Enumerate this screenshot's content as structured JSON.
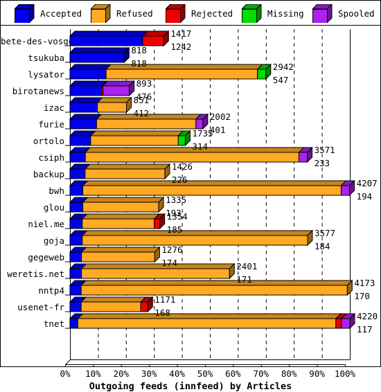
{
  "legend": {
    "items": [
      {
        "label": "Accepted",
        "color": "#0000ee",
        "icon": "cube-icon",
        "x": 20
      },
      {
        "label": "Refused",
        "color": "#ffaa22",
        "icon": "cube-icon",
        "x": 130
      },
      {
        "label": "Rejected",
        "color": "#ee0000",
        "icon": "cube-icon",
        "x": 238
      },
      {
        "label": "Missing",
        "color": "#00dd00",
        "icon": "cube-icon",
        "x": 348
      },
      {
        "label": "Spooled",
        "color": "#aa22ee",
        "icon": "cube-icon",
        "x": 450
      }
    ]
  },
  "axis": {
    "x_ticks": [
      "0%",
      "10%",
      "20%",
      "30%",
      "40%",
      "50%",
      "60%",
      "70%",
      "80%",
      "90%",
      "100%"
    ],
    "title": "Outgoing feeds (innfeed) by Articles"
  },
  "chart_data": {
    "type": "bar",
    "orientation": "horizontal",
    "stacked": true,
    "title": "Outgoing feeds (innfeed) by Articles",
    "xlabel": "Outgoing feeds (innfeed) by Articles",
    "ylabel": "",
    "xlim": [
      0,
      100
    ],
    "xunit": "%",
    "grid": true,
    "legend_position": "top",
    "series_names": [
      "Accepted",
      "Refused",
      "Rejected",
      "Missing",
      "Spooled"
    ],
    "series_colors": [
      "#0000ee",
      "#ffaa22",
      "#ee0000",
      "#00dd00",
      "#aa22ee"
    ],
    "categories": [
      "bete-des-vosges",
      "tsukuba",
      "lysator",
      "birotanews",
      "izac",
      "furie",
      "ortolo",
      "csiph",
      "backup",
      "bwh",
      "glou",
      "niel.me",
      "goja",
      "gegeweb",
      "weretis.net",
      "nntp4",
      "usenet-fr",
      "tnet"
    ],
    "rows": [
      {
        "category": "bete-des-vosges",
        "label_top": "1417",
        "label_bottom": "1242",
        "total_pct": 33.5,
        "segments": [
          {
            "name": "Accepted",
            "pct": 26.0
          },
          {
            "name": "Rejected",
            "pct": 7.5
          }
        ]
      },
      {
        "category": "tsukuba",
        "label_top": "818",
        "label_bottom": "818",
        "total_pct": 19.4,
        "segments": [
          {
            "name": "Accepted",
            "pct": 19.4
          }
        ]
      },
      {
        "category": "lysator",
        "label_top": "2942",
        "label_bottom": "547",
        "total_pct": 70.0,
        "segments": [
          {
            "name": "Accepted",
            "pct": 12.9
          },
          {
            "name": "Refused",
            "pct": 54.1
          },
          {
            "name": "Missing",
            "pct": 3.0
          }
        ]
      },
      {
        "category": "birotanews",
        "label_top": "893",
        "label_bottom": "476",
        "total_pct": 21.2,
        "segments": [
          {
            "name": "Accepted",
            "pct": 11.3
          },
          {
            "name": "Rejected",
            "pct": 0.5
          },
          {
            "name": "Spooled",
            "pct": 9.4
          }
        ]
      },
      {
        "category": "izac",
        "label_top": "851",
        "label_bottom": "412",
        "total_pct": 20.2,
        "segments": [
          {
            "name": "Accepted",
            "pct": 9.8
          },
          {
            "name": "Refused",
            "pct": 10.4
          }
        ]
      },
      {
        "category": "furie",
        "label_top": "2002",
        "label_bottom": "401",
        "total_pct": 47.5,
        "segments": [
          {
            "name": "Accepted",
            "pct": 9.5
          },
          {
            "name": "Refused",
            "pct": 35.5
          },
          {
            "name": "Spooled",
            "pct": 2.5
          }
        ]
      },
      {
        "category": "ortolo",
        "label_top": "1735",
        "label_bottom": "314",
        "total_pct": 41.2,
        "segments": [
          {
            "name": "Accepted",
            "pct": 7.4
          },
          {
            "name": "Refused",
            "pct": 31.3
          },
          {
            "name": "Missing",
            "pct": 2.5
          }
        ]
      },
      {
        "category": "csiph",
        "label_top": "3571",
        "label_bottom": "233",
        "total_pct": 84.8,
        "segments": [
          {
            "name": "Accepted",
            "pct": 5.5
          },
          {
            "name": "Refused",
            "pct": 76.3
          },
          {
            "name": "Spooled",
            "pct": 3.0
          }
        ]
      },
      {
        "category": "backup",
        "label_top": "1426",
        "label_bottom": "226",
        "total_pct": 33.9,
        "segments": [
          {
            "name": "Accepted",
            "pct": 5.4
          },
          {
            "name": "Refused",
            "pct": 28.5
          }
        ]
      },
      {
        "category": "bwh",
        "label_top": "4207",
        "label_bottom": "194",
        "total_pct": 99.9,
        "segments": [
          {
            "name": "Accepted",
            "pct": 4.6
          },
          {
            "name": "Refused",
            "pct": 92.3
          },
          {
            "name": "Spooled",
            "pct": 3.0
          }
        ]
      },
      {
        "category": "glou",
        "label_top": "1335",
        "label_bottom": "193",
        "total_pct": 31.7,
        "segments": [
          {
            "name": "Accepted",
            "pct": 4.6
          },
          {
            "name": "Refused",
            "pct": 27.1
          }
        ]
      },
      {
        "category": "niel.me",
        "label_top": "1354",
        "label_bottom": "185",
        "total_pct": 32.1,
        "segments": [
          {
            "name": "Accepted",
            "pct": 4.4
          },
          {
            "name": "Refused",
            "pct": 25.7
          },
          {
            "name": "Rejected",
            "pct": 2.0
          }
        ]
      },
      {
        "category": "goja",
        "label_top": "3577",
        "label_bottom": "184",
        "total_pct": 84.9,
        "segments": [
          {
            "name": "Accepted",
            "pct": 4.4
          },
          {
            "name": "Refused",
            "pct": 80.5
          }
        ]
      },
      {
        "category": "gegeweb",
        "label_top": "1276",
        "label_bottom": "174",
        "total_pct": 30.3,
        "segments": [
          {
            "name": "Accepted",
            "pct": 4.1
          },
          {
            "name": "Refused",
            "pct": 26.2
          }
        ]
      },
      {
        "category": "weretis.net",
        "label_top": "2401",
        "label_bottom": "171",
        "total_pct": 57.0,
        "segments": [
          {
            "name": "Accepted",
            "pct": 4.1
          },
          {
            "name": "Refused",
            "pct": 52.9
          }
        ]
      },
      {
        "category": "nntp4",
        "label_top": "4173",
        "label_bottom": "170",
        "total_pct": 99.1,
        "segments": [
          {
            "name": "Accepted",
            "pct": 4.0
          },
          {
            "name": "Refused",
            "pct": 95.1
          }
        ]
      },
      {
        "category": "usenet-fr",
        "label_top": "1171",
        "label_bottom": "168",
        "total_pct": 27.8,
        "segments": [
          {
            "name": "Accepted",
            "pct": 4.0
          },
          {
            "name": "Refused",
            "pct": 21.3
          },
          {
            "name": "Rejected",
            "pct": 2.5
          }
        ]
      },
      {
        "category": "tnet",
        "label_top": "4220",
        "label_bottom": "117",
        "total_pct": 100.0,
        "segments": [
          {
            "name": "Accepted",
            "pct": 2.8
          },
          {
            "name": "Refused",
            "pct": 92.2
          },
          {
            "name": "Rejected",
            "pct": 2.0
          },
          {
            "name": "Spooled",
            "pct": 3.0
          }
        ]
      }
    ]
  }
}
